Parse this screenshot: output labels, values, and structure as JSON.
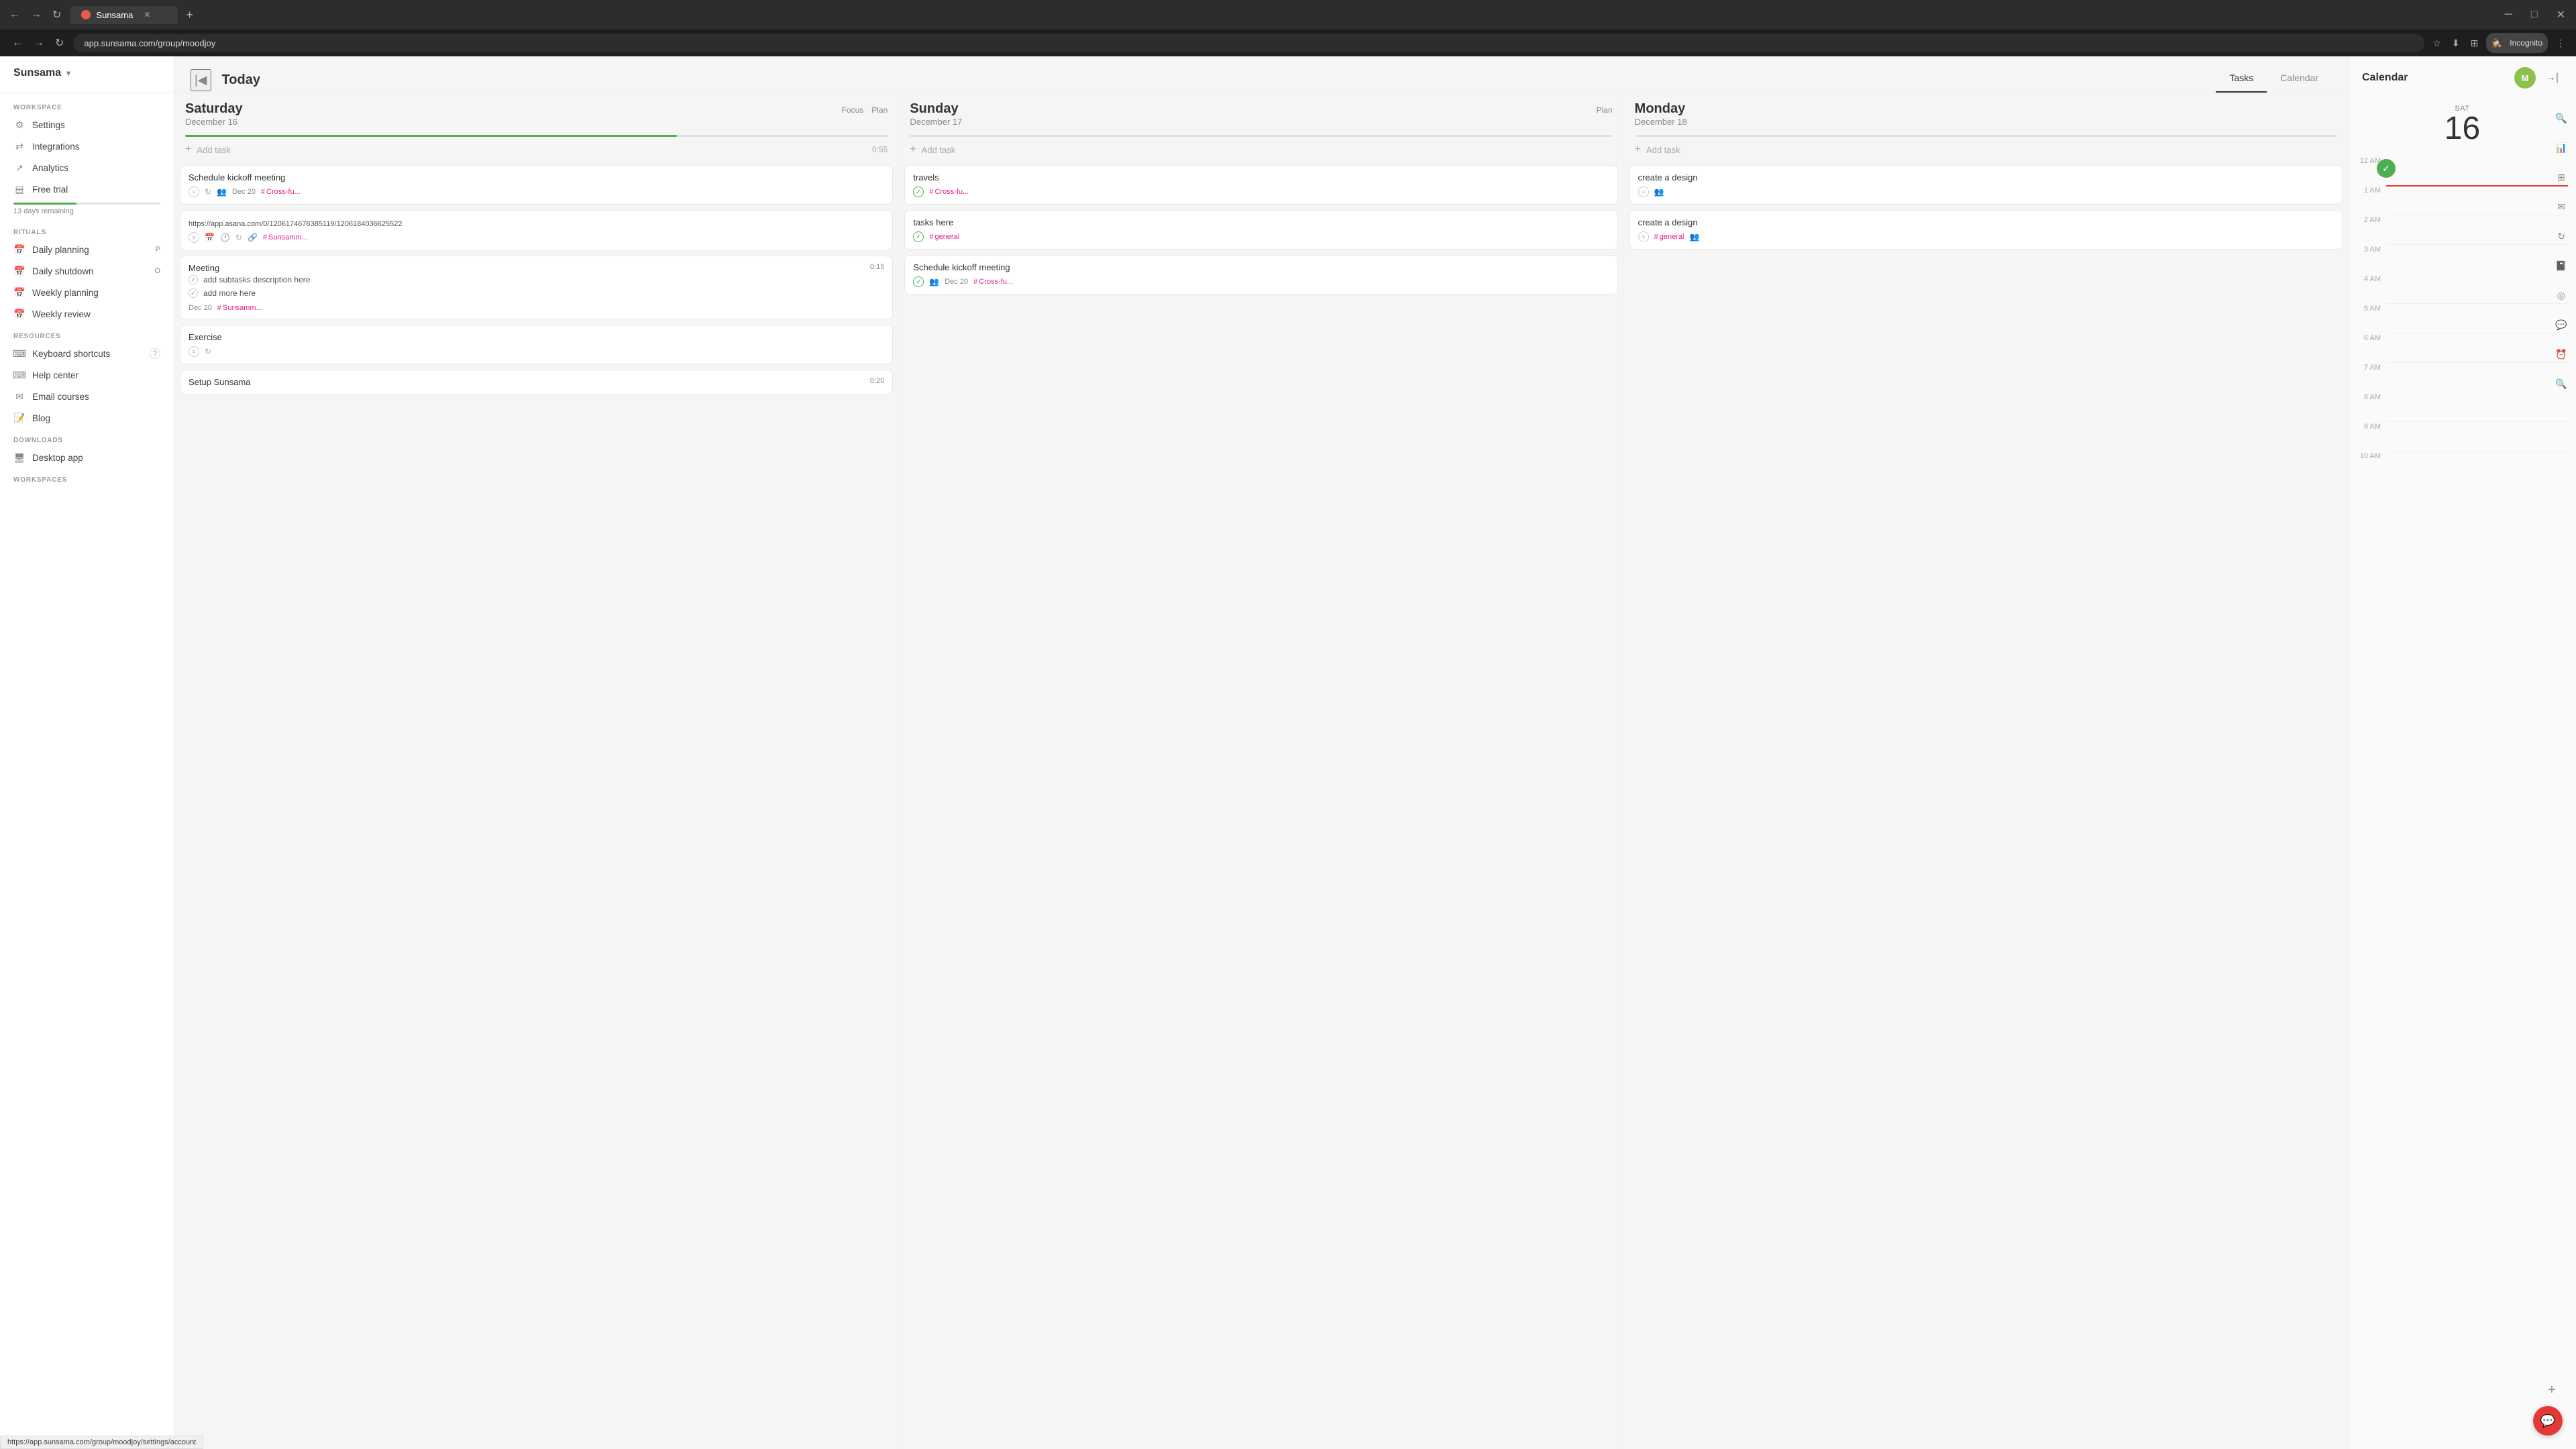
{
  "browser": {
    "tab_favicon": "S",
    "tab_title": "Sunsama",
    "url": "app.sunsama.com/group/moodjoy",
    "incognito": "Incognito"
  },
  "sidebar": {
    "brand": "Sunsama",
    "workspace_label": "WORKSPACE",
    "settings_label": "Settings",
    "integrations_label": "Integrations",
    "analytics_label": "Analytics",
    "free_trial_label": "Free trial",
    "trial_remaining": "13 days remaining",
    "rituals_label": "RITUALS",
    "daily_planning_label": "Daily planning",
    "daily_planning_badge": "P",
    "daily_shutdown_label": "Daily shutdown",
    "daily_shutdown_badge": "O",
    "weekly_planning_label": "Weekly planning",
    "weekly_review_label": "Weekly review",
    "resources_label": "RESOURCES",
    "keyboard_shortcuts_label": "Keyboard shortcuts",
    "help_center_label": "Help center",
    "email_courses_label": "Email courses",
    "blog_label": "Blog",
    "downloads_label": "DOWNLOADS",
    "desktop_app_label": "Desktop app",
    "workspaces_label": "WORKSPACES"
  },
  "main": {
    "today_label": "Today",
    "tab_tasks": "Tasks",
    "tab_calendar": "Calendar",
    "days": [
      {
        "day_name": "Saturday",
        "date_label": "December 16",
        "actions": [
          "Focus",
          "·",
          "Plan"
        ],
        "progress": 70,
        "add_task_time": "0:55",
        "tasks": [
          {
            "title": "Schedule kickoff meeting",
            "check_done": false,
            "icons": [
              "repeat",
              "people"
            ],
            "date": "Dec 20",
            "tag": "Cross-fu..."
          },
          {
            "title": "https://app.asana.com/0/1206174676385119/1206184036625522",
            "is_url": true,
            "check_done": false,
            "icons": [
              "calendar",
              "clock",
              "repeat",
              "link"
            ],
            "tag": "Sunsamm..."
          },
          {
            "title": "Meeting",
            "duration": "0:15",
            "check_done": false,
            "subtasks": [
              "add subtasks description here",
              "add more here"
            ],
            "date": "Dec 20",
            "tag": "Sunsamm..."
          },
          {
            "title": "Exercise",
            "check_done": false,
            "icons": [
              "repeat"
            ]
          },
          {
            "title": "Setup Sunsama",
            "duration": "0:20"
          }
        ]
      },
      {
        "day_name": "Sunday",
        "date_label": "December 17",
        "actions": [
          "Plan"
        ],
        "tasks": [
          {
            "title": "travels",
            "check_done": true,
            "tag": "Cross-fu..."
          },
          {
            "title": "tasks here",
            "check_done": true,
            "tag": "general"
          },
          {
            "title": "Schedule kickoff meeting",
            "check_done": true,
            "icons": [
              "people"
            ],
            "date": "Dec 20",
            "tag": "Cross-fu..."
          }
        ]
      },
      {
        "day_name": "Monday",
        "date_label": "December 18",
        "tasks": [
          {
            "title": "create a design",
            "check_done": false,
            "icons": [
              "people"
            ]
          },
          {
            "title": "create a design",
            "check_done": false,
            "tag": "general",
            "icons": [
              "people"
            ]
          }
        ]
      }
    ]
  },
  "calendar_panel": {
    "title": "Calendar",
    "day_abbrev": "SAT",
    "day_num": "16",
    "time_slots": [
      "12 AM",
      "1 AM",
      "2 AM",
      "3 AM",
      "4 AM",
      "5 AM",
      "6 AM",
      "7 AM",
      "8 AM",
      "9 AM",
      "10 AM"
    ]
  },
  "url_tooltip": "https://app.sunsama.com/group/moodjoy/settings/account"
}
